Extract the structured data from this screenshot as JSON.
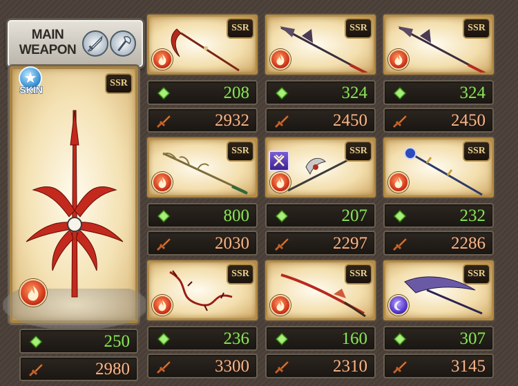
{
  "main_weapon": {
    "title_line1": "MAIN",
    "title_line2": "WEAPON",
    "skin_label": "SKIN",
    "rarity": "SSR",
    "element": "fire",
    "hp": "250",
    "atk": "2980",
    "slot_icons": [
      "sword-slot-icon",
      "axe-slot-icon"
    ]
  },
  "grid": [
    {
      "rarity": "SSR",
      "element": "fire",
      "hp": "208",
      "atk": "2932",
      "weapon_icon": "scythe-icon"
    },
    {
      "rarity": "SSR",
      "element": "fire",
      "hp": "324",
      "atk": "2450",
      "weapon_icon": "spear-icon"
    },
    {
      "rarity": "SSR",
      "element": "fire",
      "hp": "324",
      "atk": "2450",
      "weapon_icon": "spear-icon"
    },
    {
      "rarity": "SSR",
      "element": "fire",
      "hp": "800",
      "atk": "2030",
      "weapon_icon": "branch-staff-icon"
    },
    {
      "rarity": "SSR",
      "element": "fire",
      "hp": "207",
      "atk": "2297",
      "weapon_icon": "halberd-icon",
      "skill_icon": "crossed-swords-skill-icon"
    },
    {
      "rarity": "SSR",
      "element": "fire",
      "hp": "232",
      "atk": "2286",
      "weapon_icon": "orb-staff-icon"
    },
    {
      "rarity": "SSR",
      "element": "fire",
      "hp": "236",
      "atk": "3300",
      "weapon_icon": "thorn-whip-icon"
    },
    {
      "rarity": "SSR",
      "element": "fire",
      "hp": "160",
      "atk": "2310",
      "weapon_icon": "katana-icon"
    },
    {
      "rarity": "SSR",
      "element": "dark",
      "hp": "307",
      "atk": "3145",
      "weapon_icon": "dark-scythe-icon"
    }
  ],
  "colors": {
    "hp_text": "#8be25a",
    "atk_text": "#f6b78a",
    "card_frame": "#b38b45"
  }
}
